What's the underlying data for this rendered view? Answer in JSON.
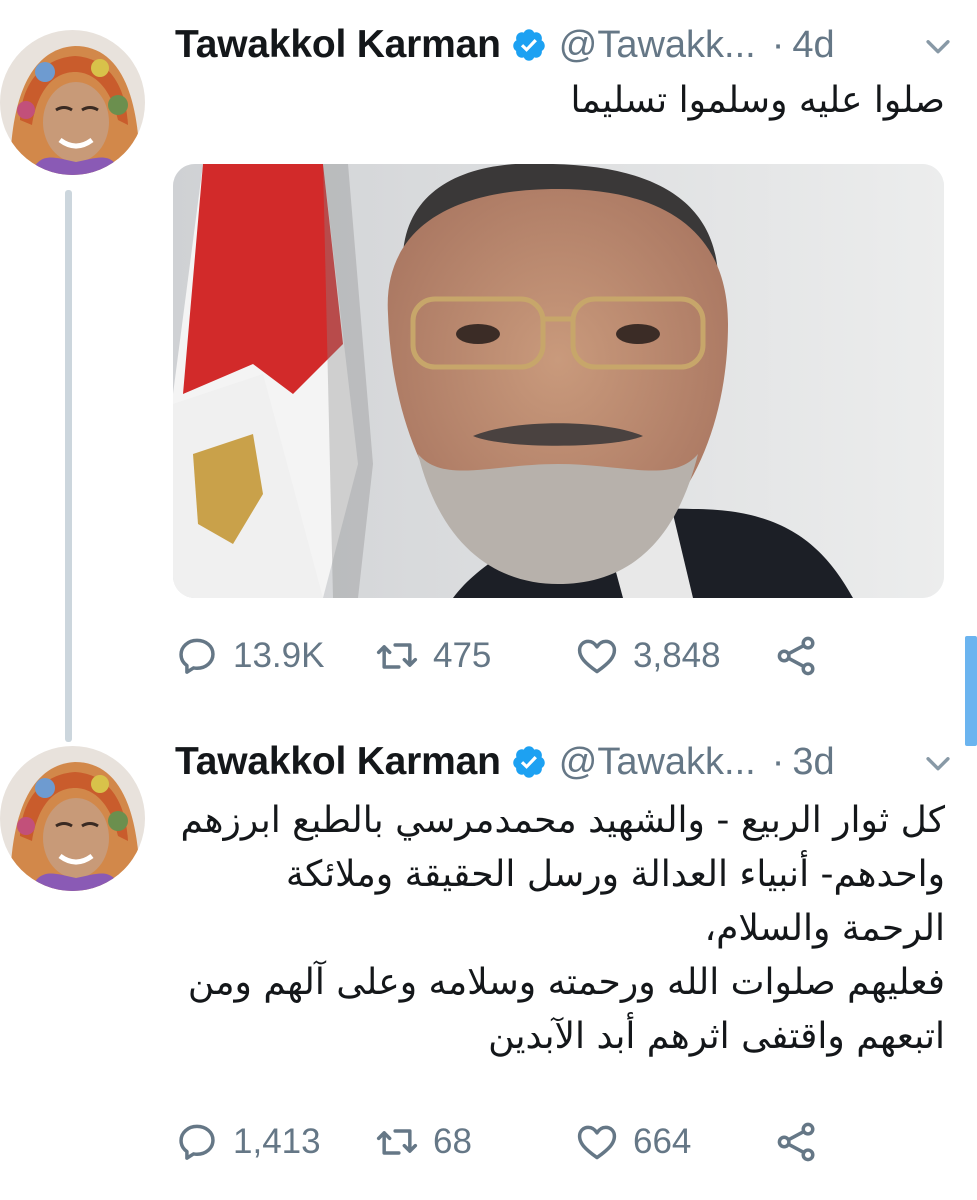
{
  "tweets": [
    {
      "author_name": "Tawakkol Karman",
      "handle": "@Tawakk...",
      "separator": "·",
      "time": "4d",
      "text": "صلوا عليه وسلموا تسليما",
      "stats": {
        "replies": "13.9K",
        "retweets": "475",
        "likes": "3,848"
      }
    },
    {
      "author_name": "Tawakkol Karman",
      "handle": "@Tawakk...",
      "separator": "·",
      "time": "3d",
      "text": "كل ثوار الربيع - والشهيد محمدمرسي بالطبع ابرزهم\nواحدهم- أنبياء العدالة ورسل الحقيقة وملائكة\nالرحمة والسلام،\nفعليهم صلوات الله ورحمته وسلامه وعلى آلهم ومن\nاتبعهم واقتفى اثرهم أبد الآبدين",
      "stats": {
        "replies": "1,413",
        "retweets": "68",
        "likes": "664"
      }
    }
  ],
  "icons": {
    "verified": "verified-badge-icon",
    "caret": "chevron-down-icon",
    "reply": "reply-icon",
    "retweet": "retweet-icon",
    "like": "heart-icon",
    "share": "share-icon"
  },
  "colors": {
    "verified_blue": "#1da1f2",
    "secondary_text": "#657786",
    "thread_line": "#ccd6dd",
    "scrollbar": "#6bb4ef"
  }
}
